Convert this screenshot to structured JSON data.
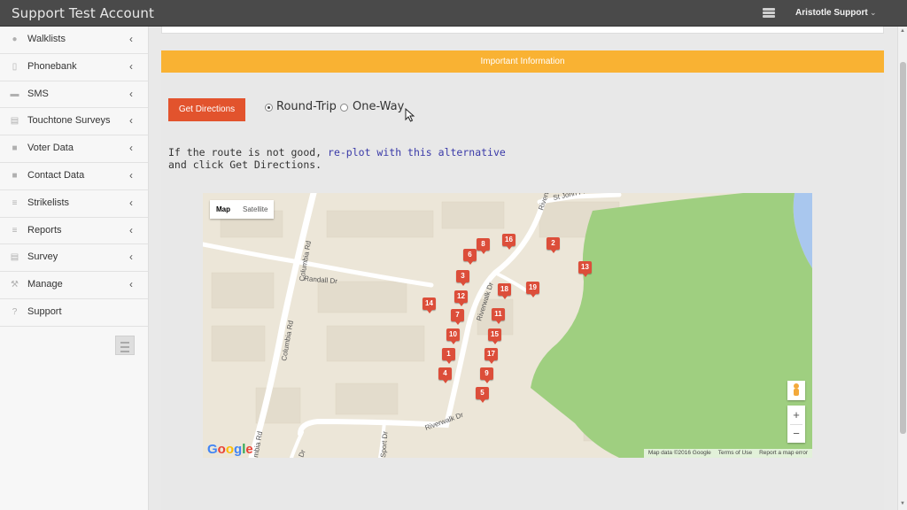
{
  "app": {
    "title": "Support Test Account",
    "user": "Aristotle Support"
  },
  "sidebar": {
    "items": [
      {
        "label": "Walklists",
        "icon": "map-pin-icon",
        "has_chevron": true
      },
      {
        "label": "Phonebank",
        "icon": "mobile-phone-icon",
        "has_chevron": true
      },
      {
        "label": "SMS",
        "icon": "chat-bubbles-icon",
        "has_chevron": true
      },
      {
        "label": "Touchtone Surveys",
        "icon": "document-icon",
        "has_chevron": true
      },
      {
        "label": "Voter Data",
        "icon": "briefcase-icon",
        "has_chevron": true
      },
      {
        "label": "Contact Data",
        "icon": "briefcase-icon",
        "has_chevron": true
      },
      {
        "label": "Strikelists",
        "icon": "list-icon",
        "has_chevron": true
      },
      {
        "label": "Reports",
        "icon": "list-icon",
        "has_chevron": true
      },
      {
        "label": "Survey",
        "icon": "document-icon",
        "has_chevron": true
      },
      {
        "label": "Manage",
        "icon": "wrench-icon",
        "has_chevron": true
      },
      {
        "label": "Support",
        "icon": "question-circle-icon",
        "has_chevron": false
      }
    ]
  },
  "panel": {
    "header": "Important Information"
  },
  "directions": {
    "button_label": "Get Directions",
    "options": [
      {
        "label": "Round-Trip",
        "checked": true
      },
      {
        "label": "One-Way",
        "checked": false
      }
    ],
    "note_prefix": "If the route is not good,",
    "note_link": "re-plot with this alternative",
    "note_suffix": "and click Get Directions."
  },
  "map": {
    "type_options": [
      {
        "label": "Map",
        "active": true
      },
      {
        "label": "Satellite",
        "active": false
      }
    ],
    "streets": [
      "Columbia Rd",
      "Randall Dr",
      "Riverwalk Dr",
      "St John Pl",
      "Sport Dr"
    ],
    "markers": [
      "1",
      "2",
      "3",
      "4",
      "5",
      "6",
      "7",
      "8",
      "9",
      "10",
      "11",
      "12",
      "13",
      "14",
      "15",
      "16",
      "17",
      "18",
      "19"
    ],
    "google_logo": "Google",
    "attribution": [
      "Map data ©2016 Google",
      "Terms of Use",
      "Report a map error"
    ],
    "zoom_in": "+",
    "zoom_out": "−",
    "colors": {
      "background": "#ece6d8",
      "park": "#9fcf80",
      "water": "#a9c7ee",
      "marker": "#dc4e3a"
    }
  },
  "colors": {
    "topbar": "#4a4a4a",
    "header_bar": "#f9b233",
    "button": "#e2532d",
    "link": "#3a3aa8"
  }
}
